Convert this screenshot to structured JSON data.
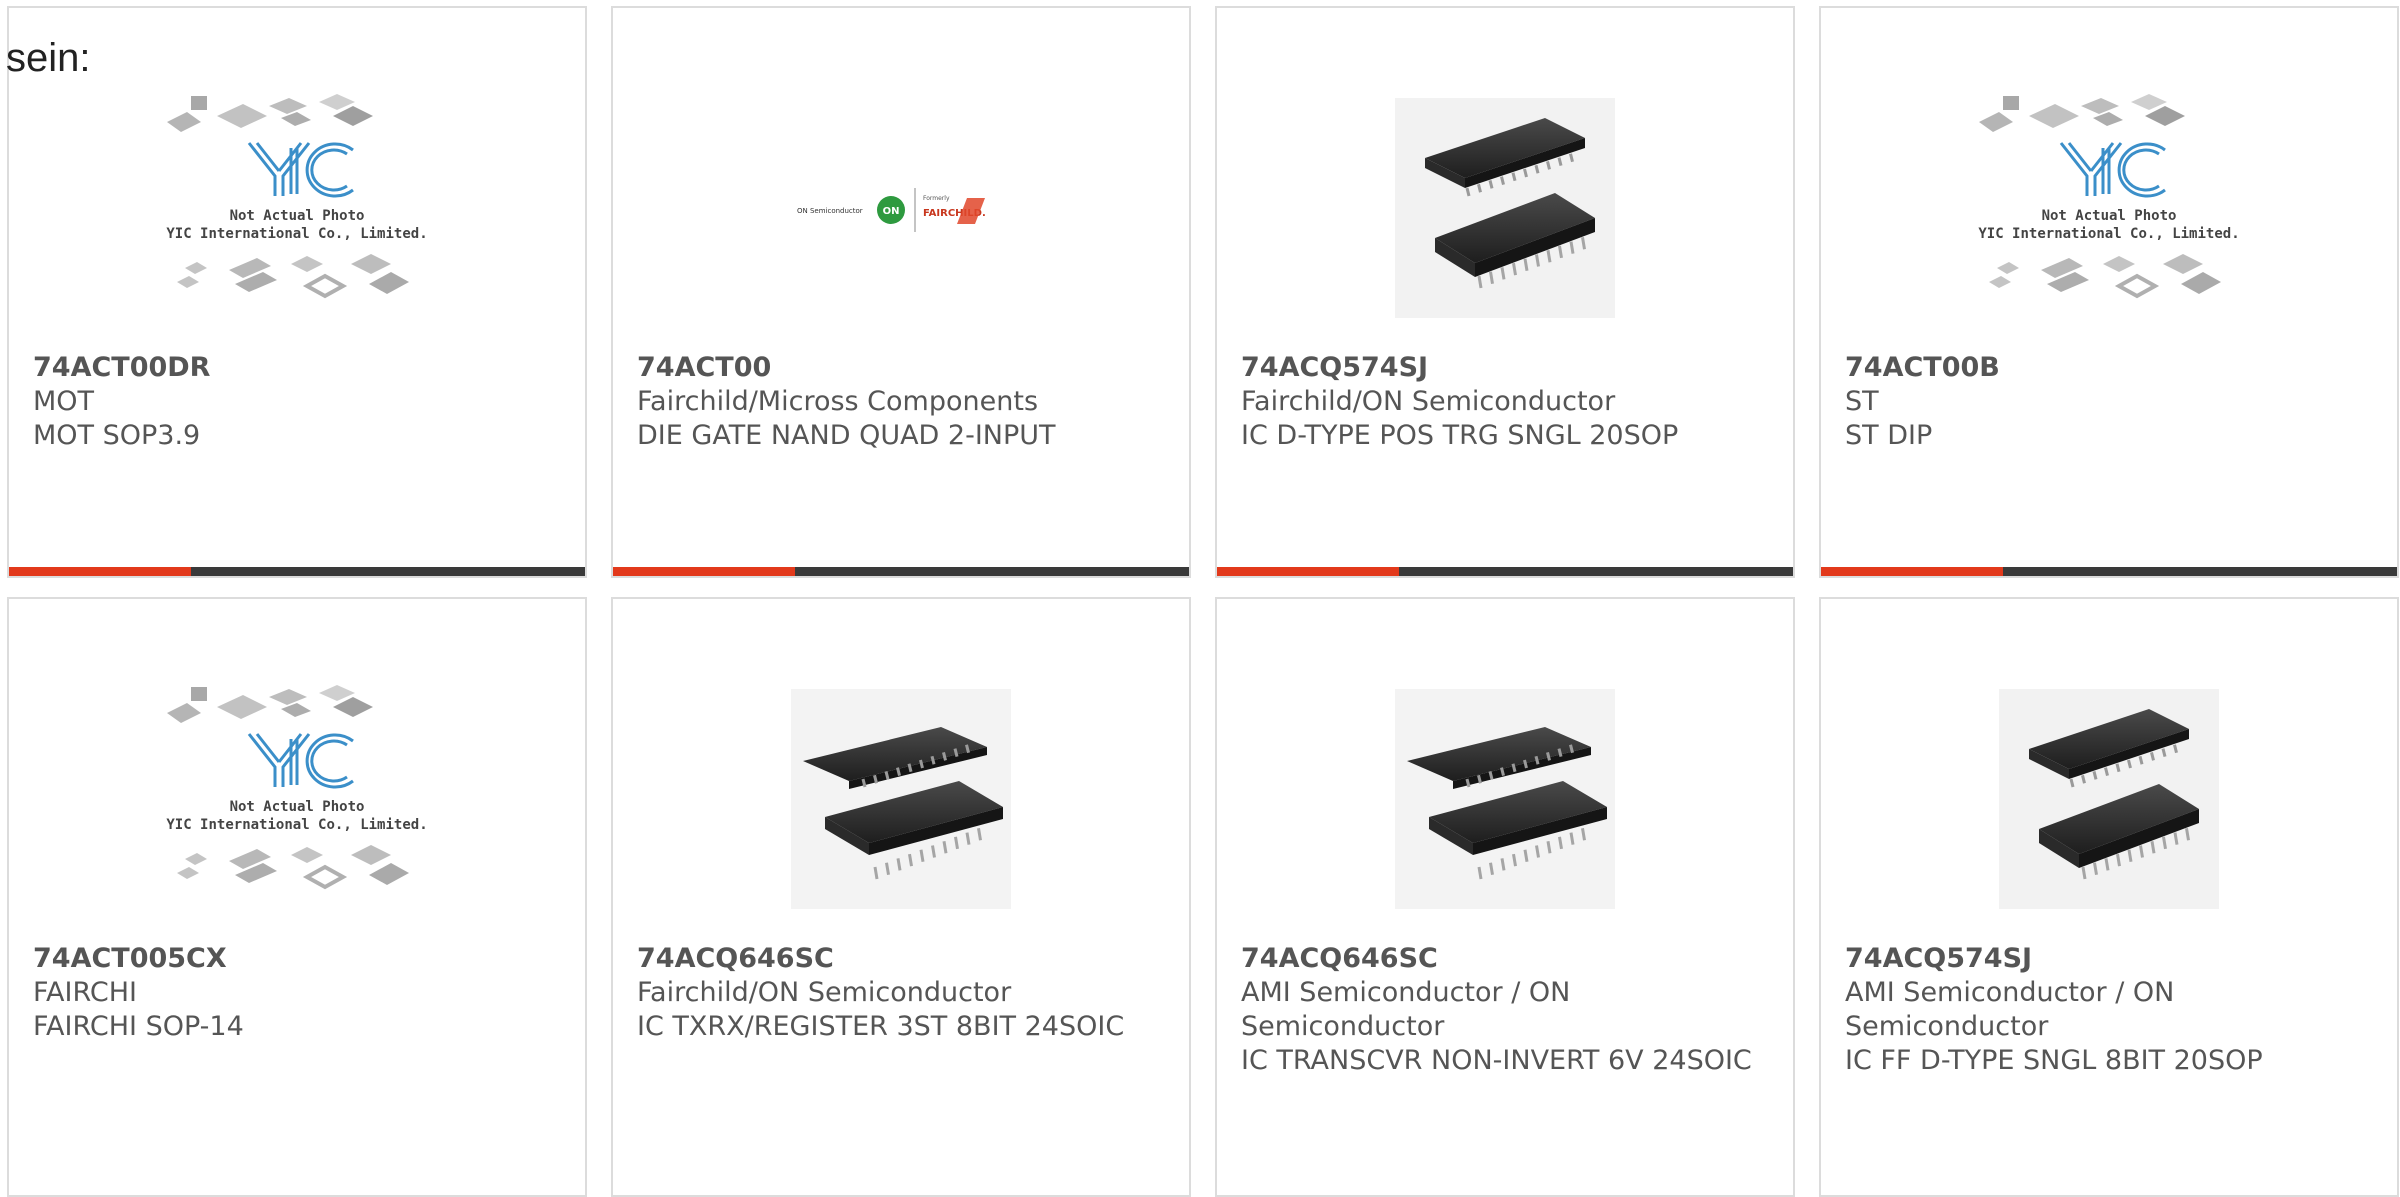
{
  "page": {
    "leading_text": "sein:"
  },
  "colors": {
    "accent": "#e2391b",
    "bar": "#3a3a3a",
    "border": "#dcdcdc",
    "yic_blue": "#3b8fc9"
  },
  "placeholder": {
    "line1": "Not Actual Photo",
    "line2": "YIC International Co., Limited.",
    "logo": "YIC"
  },
  "logo_image": {
    "left": "ON Semiconductor",
    "mark": "ON",
    "formerly": "Formerly",
    "right": "FAIRCHILD."
  },
  "products": [
    {
      "image": "placeholder",
      "part": "74ACT00DR",
      "maker": "MOT",
      "desc": "MOT SOP3.9"
    },
    {
      "image": "on-fairchild-logo",
      "part": "74ACT00",
      "maker": "Fairchild/Micross Components",
      "desc": "DIE GATE NAND QUAD 2-INPUT"
    },
    {
      "image": "chip-sop-20",
      "part": "74ACQ574SJ",
      "maker": "Fairchild/ON Semiconductor",
      "desc": "IC D-TYPE POS TRG SNGL 20SOP"
    },
    {
      "image": "placeholder",
      "part": "74ACT00B",
      "maker": "ST",
      "desc": "ST DIP"
    },
    {
      "image": "placeholder",
      "part": "74ACT005CX",
      "maker": "FAIRCHI",
      "desc": "FAIRCHI SOP-14"
    },
    {
      "image": "chip-soic-24",
      "part": "74ACQ646SC",
      "maker": "Fairchild/ON Semiconductor",
      "desc": "IC TXRX/REGISTER 3ST 8BIT 24SOIC"
    },
    {
      "image": "chip-soic-24",
      "part": "74ACQ646SC",
      "maker": "AMI Semiconductor / ON Semiconductor",
      "desc": "IC TRANSCVR NON-INVERT 6V 24SOIC"
    },
    {
      "image": "chip-sop-20",
      "part": "74ACQ574SJ",
      "maker": "AMI Semiconductor / ON Semiconductor",
      "desc": "IC FF D-TYPE SNGL 8BIT 20SOP"
    }
  ]
}
